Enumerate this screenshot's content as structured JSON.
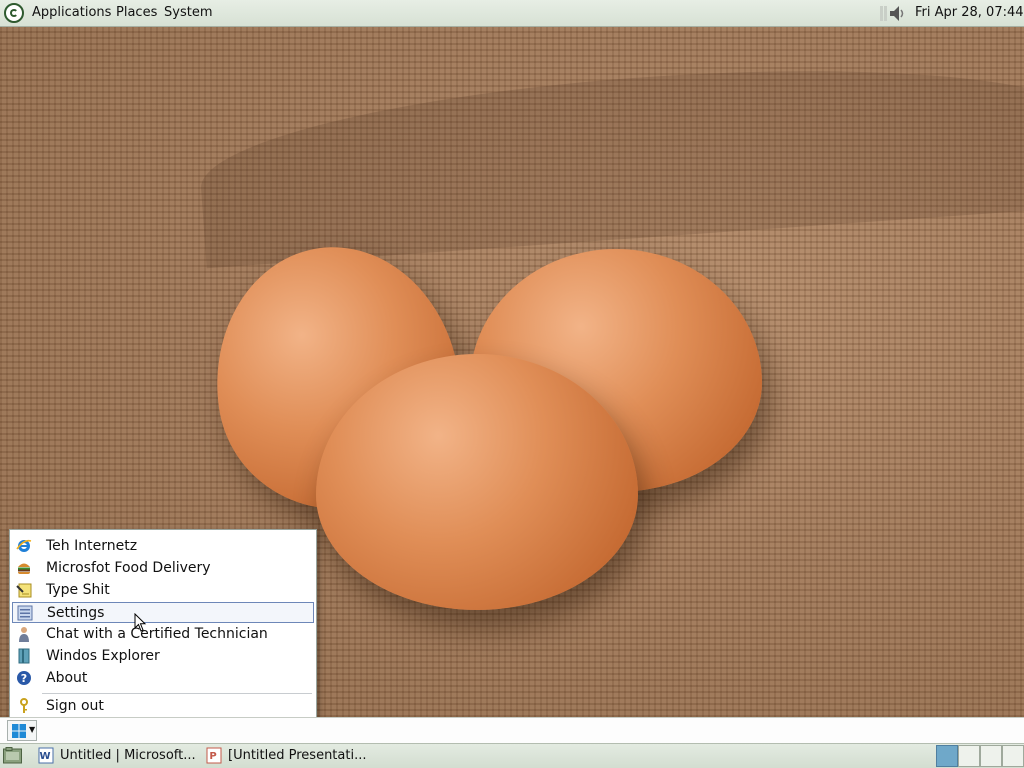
{
  "top_panel": {
    "menus": {
      "applications": "Applications",
      "places": "Places",
      "system": "System"
    },
    "clock": "Fri Apr 28, 07:44",
    "icons": {
      "distro": "distro-logo-icon",
      "volume": "volume-icon"
    }
  },
  "start_menu": {
    "items": [
      {
        "label": "Teh Internetz",
        "icon": "internet-explorer-icon"
      },
      {
        "label": "Microsfot Food Delivery",
        "icon": "burger-icon"
      },
      {
        "label": "Type Shit",
        "icon": "notepad-icon"
      },
      {
        "label": "Settings",
        "icon": "settings-icon",
        "selected": true
      },
      {
        "label": "Chat with a Certified Technician",
        "icon": "technician-icon"
      },
      {
        "label": "Windos Explorer",
        "icon": "explorer-icon"
      },
      {
        "label": "About",
        "icon": "help-icon"
      },
      {
        "label": "Sign out",
        "icon": "key-icon"
      }
    ]
  },
  "taskbar": {
    "start_button_icon": "windows-logo-icon",
    "tasks": [
      {
        "label": "Untitled | Microsoft...",
        "icon": "word-icon"
      },
      {
        "label": "[Untitled Presentati...",
        "icon": "presentation-icon"
      }
    ],
    "show_desktop_icon": "show-desktop-icon",
    "workspaces": 4,
    "active_workspace": 1
  },
  "colors": {
    "panel": "#dbe4d8",
    "selection_border": "#6d87b8",
    "accent_blue": "#1f7fd6"
  }
}
